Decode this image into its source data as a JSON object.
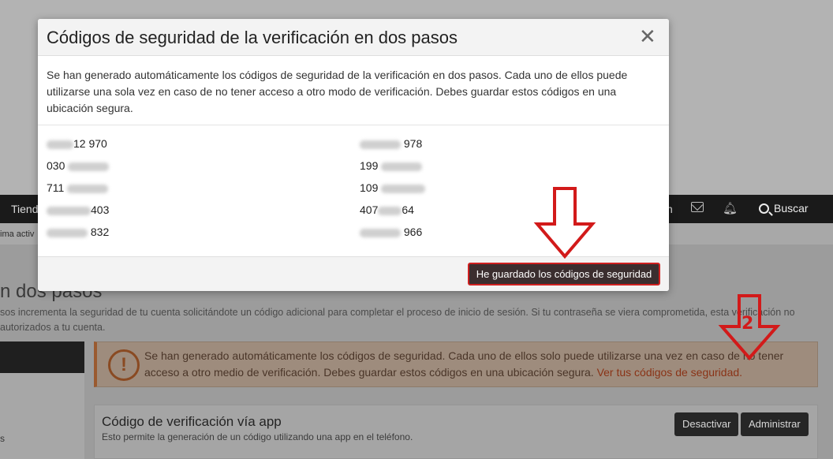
{
  "background": {
    "nav": {
      "store_label": "Tiend",
      "partial_label": "n",
      "search_label": "Buscar"
    },
    "subbar_text": "ima activ",
    "page_title": "n dos pasos",
    "page_desc": "sos incrementa la seguridad de tu cuenta solicitándote un código adicional para completar el proceso de inicio de sesión. Si tu contraseña se viera comprometida, esta verificación no autorizados a tu cuenta.",
    "left_nav_text": "s",
    "alert": {
      "text": "Se han generado automáticamente los códigos de seguridad. Cada uno de ellos solo puede utilizarse una vez en caso de no tener acceso a otro medio de verificación. Debes guardar estos códigos en una ubicación segura.",
      "link": "Ver tus códigos de seguridad."
    },
    "card": {
      "title": "Código de verificación vía app",
      "desc": "Esto permite la generación de un código utilizando una app en el teléfono.",
      "deactivate_label": "Desactivar",
      "manage_label": "Administrar"
    }
  },
  "modal": {
    "title": "Códigos de seguridad de la verificación en dos pasos",
    "body": "Se han generado automáticamente los códigos de seguridad de la verificación en dos pasos. Cada uno de ellos puede utilizarse una sola vez en caso de no tener acceso a otro modo de verificación. Debes guardar estos códigos en una ubicación segura.",
    "codes_left": [
      "12 970",
      "030",
      "711",
      "403",
      "832"
    ],
    "codes_right": [
      "978",
      "199",
      "109",
      "407",
      "64",
      "966"
    ],
    "confirm_label": "He guardado los códigos de seguridad"
  },
  "annotation": {
    "number": "2",
    "color": "#d21a1a"
  }
}
